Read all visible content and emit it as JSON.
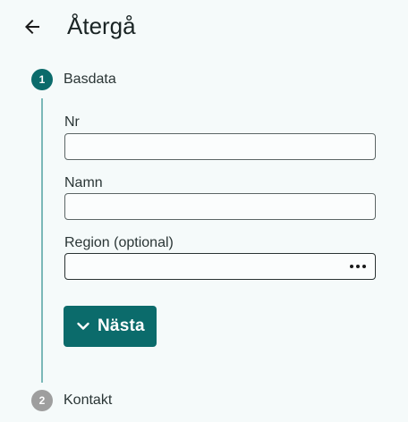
{
  "header": {
    "back_icon": "arrow-left-icon",
    "title": "Återgå"
  },
  "stepper": {
    "steps": [
      {
        "number": "1",
        "label": "Basdata",
        "state": "active"
      },
      {
        "number": "2",
        "label": "Kontakt",
        "state": "inactive"
      }
    ]
  },
  "form": {
    "nr": {
      "label": "Nr",
      "value": ""
    },
    "namn": {
      "label": "Namn",
      "value": ""
    },
    "region": {
      "label": "Region (optional)",
      "value": "",
      "icon": "more-horizontal-icon"
    }
  },
  "actions": {
    "next_label": "Nästa",
    "next_icon": "chevron-down-icon"
  },
  "colors": {
    "accent": "#0b6b6b",
    "step_line": "#7bb8b8",
    "inactive_step": "#9e9e9e",
    "background": "#f5fafa"
  }
}
